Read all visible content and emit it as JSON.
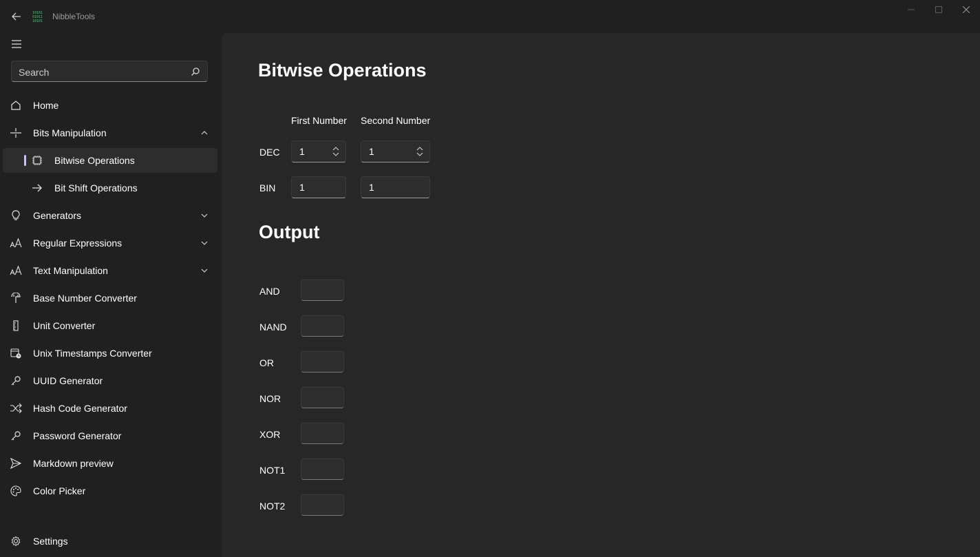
{
  "app": {
    "title": "NibbleTools",
    "logo_text": "10101",
    "accent_color": "#c7c5f5",
    "logo_color": "#3fcf6a"
  },
  "window_controls": [
    "minimize-icon",
    "maximize-icon",
    "close-icon"
  ],
  "sidebar": {
    "search": {
      "placeholder": "Search",
      "value": ""
    },
    "items": [
      {
        "label": "Home",
        "icon": "home-icon"
      },
      {
        "label": "Bits Manipulation",
        "icon": "bits-icon",
        "expanded": true
      },
      {
        "label": "Bitwise Operations",
        "icon": "chip-icon",
        "selected": true
      },
      {
        "label": "Bit Shift Operations",
        "icon": "arrow-right-icon"
      },
      {
        "label": "Generators",
        "icon": "lightbulb-icon",
        "expanded": false
      },
      {
        "label": "Regular Expressions",
        "icon": "font-size-icon",
        "expanded": false
      },
      {
        "label": "Text Manipulation",
        "icon": "font-size-icon",
        "expanded": false
      },
      {
        "label": "Base Number Converter",
        "icon": "pivot-icon"
      },
      {
        "label": "Unit Converter",
        "icon": "ruler-icon"
      },
      {
        "label": "Unix Timestamps Converter",
        "icon": "calendar-clock-icon"
      },
      {
        "label": "UUID Generator",
        "icon": "key-icon"
      },
      {
        "label": "Hash Code Generator",
        "icon": "shuffle-icon"
      },
      {
        "label": "Password Generator",
        "icon": "key-icon"
      },
      {
        "label": "Markdown preview",
        "icon": "send-icon"
      },
      {
        "label": "Color Picker",
        "icon": "palette-icon"
      }
    ],
    "settings": {
      "label": "Settings",
      "icon": "gear-icon"
    }
  },
  "main": {
    "title": "Bitwise Operations",
    "columns": [
      "First Number",
      "Second Number"
    ],
    "rows": {
      "dec": {
        "label": "DEC",
        "first": "1",
        "second": "1"
      },
      "bin": {
        "label": "BIN",
        "first": "1",
        "second": "1"
      }
    },
    "output": {
      "title": "Output",
      "items": [
        {
          "label": "AND",
          "value": ""
        },
        {
          "label": "NAND",
          "value": ""
        },
        {
          "label": "OR",
          "value": ""
        },
        {
          "label": "NOR",
          "value": ""
        },
        {
          "label": "XOR",
          "value": ""
        },
        {
          "label": "NOT1",
          "value": ""
        },
        {
          "label": "NOT2",
          "value": ""
        }
      ]
    }
  }
}
